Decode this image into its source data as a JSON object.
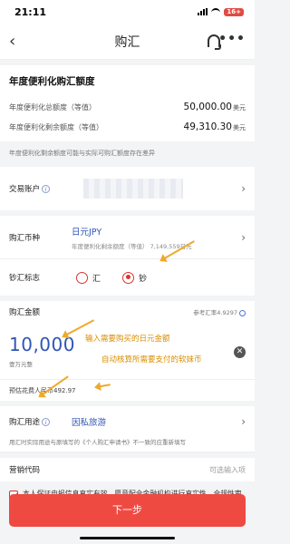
{
  "status": {
    "time": "21:11",
    "battery": "16+"
  },
  "nav": {
    "title": "购汇"
  },
  "quota": {
    "heading": "年度便利化购汇额度",
    "total_label": "年度便利化总额度（等值）",
    "total_value": "50,000.00",
    "remain_label": "年度便利化剩余额度（等值）",
    "remain_value": "49,310.30",
    "unit": "美元",
    "note": "年度便利化剩余额度可能与实际可购汇额度存在差异"
  },
  "account": {
    "label": "交易账户",
    "info": "i"
  },
  "currency": {
    "label": "购汇币种",
    "value": "日元JPY",
    "sub": "年度便利化剩余额度（等值） 7,149,559日元"
  },
  "flag": {
    "label": "钞汇标志",
    "options": [
      "汇",
      "钞"
    ],
    "selected": "钞"
  },
  "amount": {
    "label": "购汇金额",
    "rate": "参考汇率4.9297",
    "value": "10,000",
    "wan": "壹万元整",
    "cost": "预估花费人民币492.97"
  },
  "purpose": {
    "label": "购汇用途",
    "value": "因私旅游",
    "note": "用汇时实际用途与原填写的《个人购汇申请书》不一致的应重新填写"
  },
  "marketing": {
    "label": "营销代码",
    "placeholder": "可选输入项"
  },
  "declaration": "本人保证申报信息真实有效，愿意配合金融机构进行真实性、合规性审核，愿意配合外汇管理机关调查和监督检查，并承担相应法律责任。",
  "button": {
    "next": "下一步"
  },
  "annotations": {
    "amount_hint": "输入需要购买的日元金额",
    "cost_hint": "自动核算所需要支付的软妹币"
  },
  "colors": {
    "accent": "#ef4a42",
    "link": "#2f55b5",
    "annotation": "#f0a92a"
  },
  "icons": [
    "back-icon",
    "headset-icon",
    "more-icon",
    "info-icon",
    "chevron-right-icon",
    "refresh-icon",
    "clear-icon",
    "checkbox-icon"
  ]
}
